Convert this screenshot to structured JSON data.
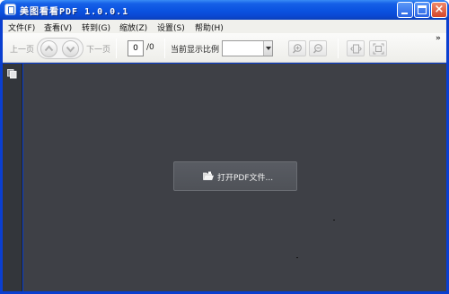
{
  "window": {
    "title": "美图看看PDF 1.0.0.1",
    "minimize_label": "_",
    "close_label": "×"
  },
  "menu": {
    "items": [
      {
        "label": "文件(F)"
      },
      {
        "label": "查看(V)"
      },
      {
        "label": "转到(G)"
      },
      {
        "label": "缩放(Z)"
      },
      {
        "label": "设置(S)"
      },
      {
        "label": "帮助(H)"
      }
    ]
  },
  "toolbar": {
    "prev_page_label": "上一页",
    "next_page_label": "下一页",
    "page_current": "0",
    "page_total": "/0",
    "zoom_label": "当前显示比例",
    "zoom_value": "",
    "overflow_label": "»"
  },
  "viewer": {
    "open_button_label": "打开PDF文件..."
  },
  "colors": {
    "titlebar_blue": "#0a52e0",
    "viewer_background": "#3e4046",
    "sidestrip_background": "#33363b"
  }
}
